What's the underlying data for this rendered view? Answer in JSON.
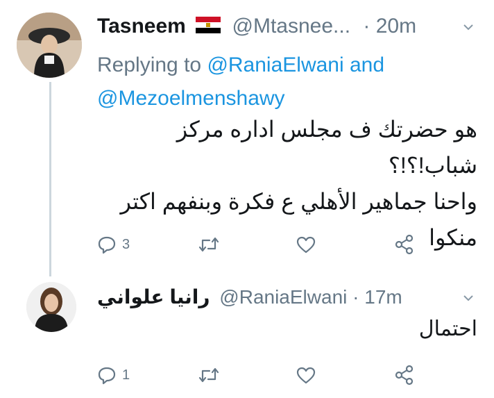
{
  "tweet1": {
    "name": "Tasneem",
    "flag_icon": "egypt-flag",
    "handle": "@Mtasnee...",
    "separator": "·",
    "time": "20m",
    "reply_prefix": "Replying to",
    "reply_user1": "@RaniaElwani",
    "reply_and": "and",
    "reply_user2": "@Mezoelmenshawy",
    "text_line1": "هو حضرتك ف مجلس اداره مركز شباب!؟!؟",
    "text_line2": "واحنا جماهير الأهلي ع فكرة وبنفهم اكتر",
    "text_line3": "منكوا",
    "reply_count": "3",
    "retweet_count": "",
    "like_count": ""
  },
  "tweet2": {
    "name": "رانيا علواني",
    "handle": "@RaniaElwani",
    "separator": "·",
    "time": "17m",
    "text": "احتمال",
    "reply_count": "1",
    "retweet_count": "",
    "like_count": ""
  },
  "colors": {
    "muted": "#657786",
    "link": "#1b95e0",
    "text": "#14171a",
    "thread_line": "#ccd6dd"
  }
}
